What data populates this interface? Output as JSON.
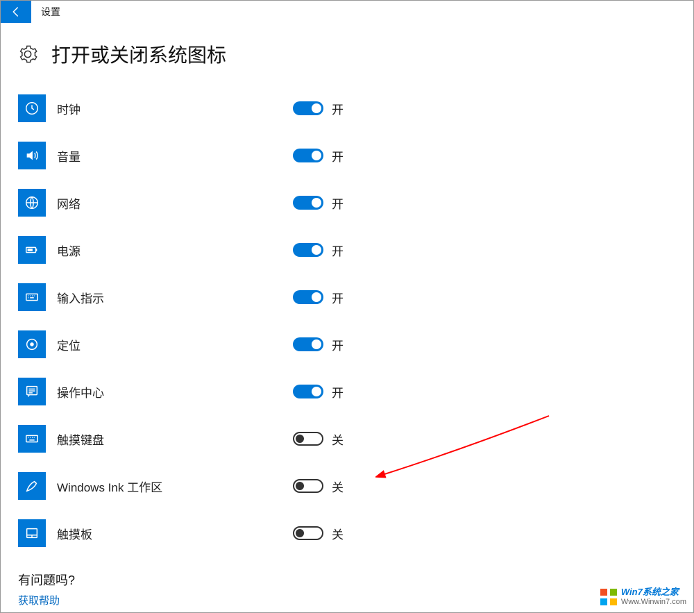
{
  "topbar": {
    "title": "设置"
  },
  "page": {
    "title": "打开或关闭系统图标"
  },
  "labels": {
    "on": "开",
    "off": "关"
  },
  "items": [
    {
      "icon": "clock-icon",
      "label": "时钟",
      "state": "on"
    },
    {
      "icon": "volume-icon",
      "label": "音量",
      "state": "on"
    },
    {
      "icon": "network-icon",
      "label": "网络",
      "state": "on"
    },
    {
      "icon": "power-icon",
      "label": "电源",
      "state": "on"
    },
    {
      "icon": "keyboard-icon",
      "label": "输入指示",
      "state": "on"
    },
    {
      "icon": "location-icon",
      "label": "定位",
      "state": "on"
    },
    {
      "icon": "action-center-icon",
      "label": "操作中心",
      "state": "on"
    },
    {
      "icon": "touch-keyboard-icon",
      "label": "触摸键盘",
      "state": "off"
    },
    {
      "icon": "ink-icon",
      "label": "Windows Ink 工作区",
      "state": "off"
    },
    {
      "icon": "touchpad-icon",
      "label": "触摸板",
      "state": "off"
    }
  ],
  "help": {
    "question": "有问题吗?",
    "link": "获取帮助"
  },
  "watermark": {
    "line1": "Win7系统之家",
    "line2": "Www.Winwin7.com"
  },
  "annotation": {
    "arrow_target_index": 8
  }
}
